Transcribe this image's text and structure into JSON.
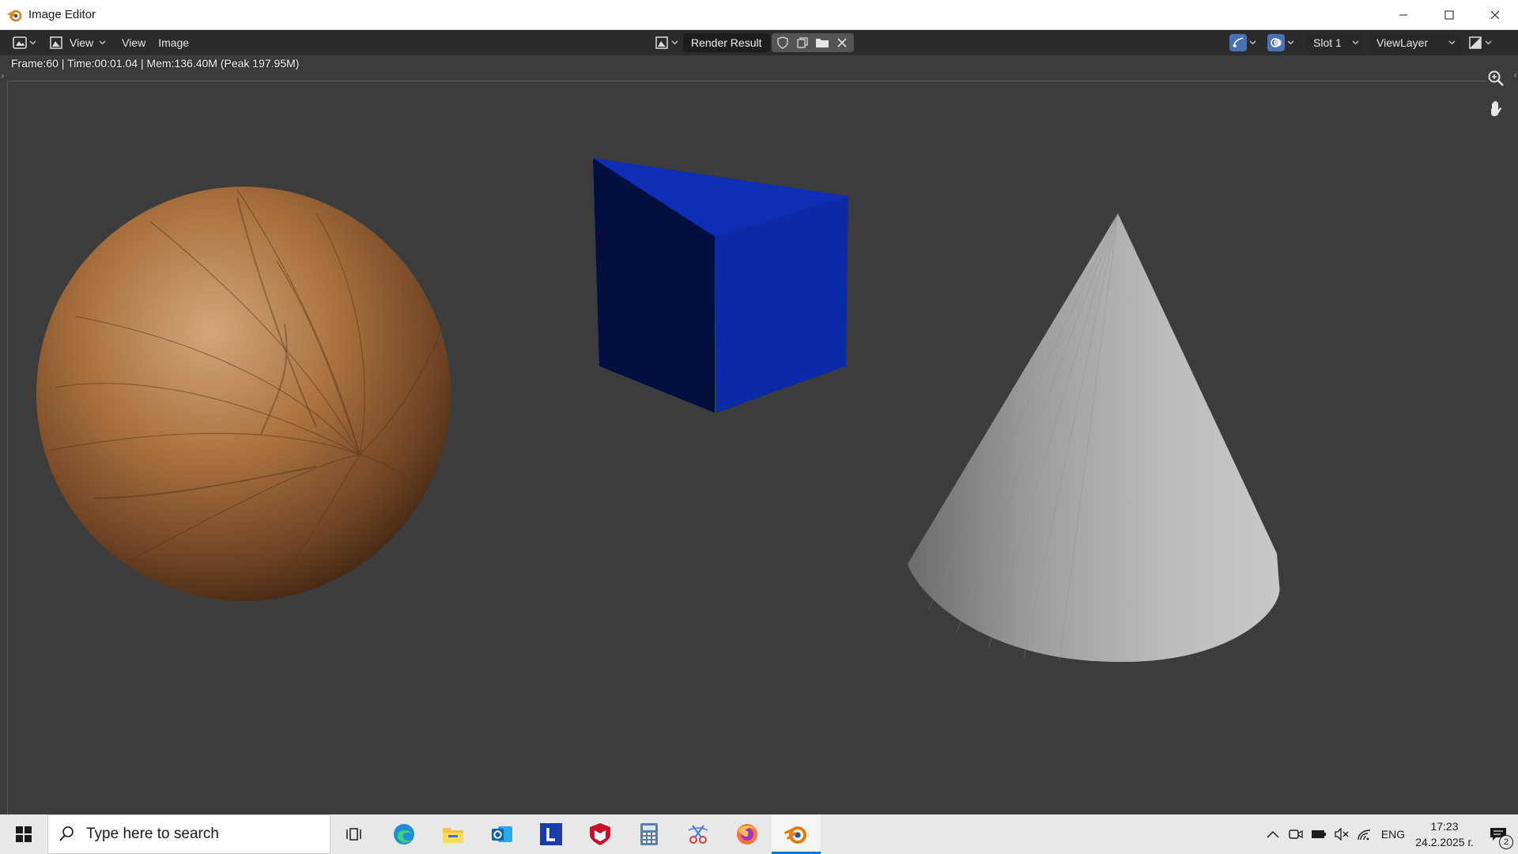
{
  "window": {
    "title": "Image Editor"
  },
  "header": {
    "editor_view_label": "View",
    "menus": [
      "View",
      "Image"
    ],
    "image_name": "Render Result",
    "slot": "Slot 1",
    "view_layer": "ViewLayer"
  },
  "status": {
    "text": "Frame:60 | Time:00:01.04 | Mem:136.40M (Peak 197.95M)"
  },
  "scene": {
    "sphere_color": "#8a5a35",
    "cube_color": "#0b2aa8",
    "cone_color": "#b5b5b5",
    "background_color": "#3c3c3c"
  },
  "taskbar": {
    "search_placeholder": "Type here to search",
    "apps": [
      "task-view",
      "edge",
      "file-explorer",
      "outlook",
      "l-app",
      "mcafee",
      "calculator",
      "snipping-tool",
      "firefox",
      "blender"
    ],
    "active_app": "blender",
    "language": "ENG",
    "time": "17:23",
    "date": "24.2.2025 г.",
    "notification_count": "2"
  },
  "colors": {
    "accent": "#4772b3",
    "blender_orange": "#e87d0d",
    "taskbar_bg": "#e8e8e8",
    "header_bg": "#2b2b2b"
  }
}
